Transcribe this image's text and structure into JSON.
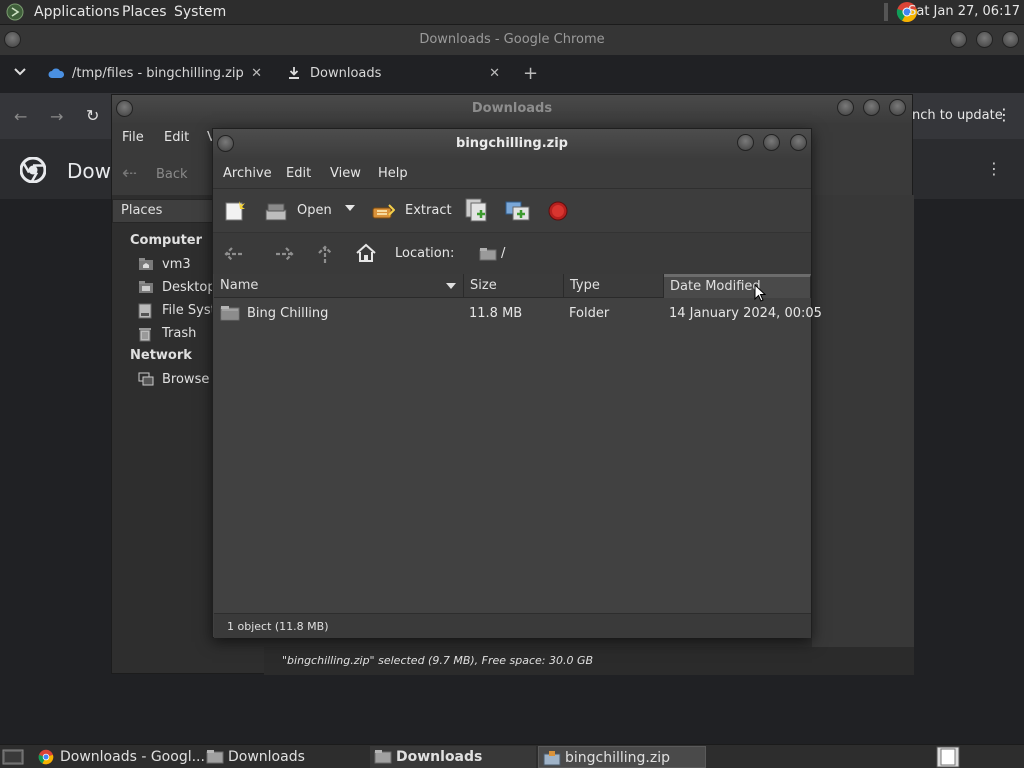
{
  "top_panel": {
    "menus": [
      "Applications",
      "Places",
      "System"
    ],
    "clock": "Sat Jan 27, 06:17"
  },
  "chrome": {
    "window_title": "Downloads - Google Chrome",
    "tabs": [
      {
        "label": "/tmp/files - bingchilling.zip"
      },
      {
        "label": "Downloads"
      }
    ],
    "update_text": "nch to update",
    "page_title": "Dow"
  },
  "nautilus": {
    "window_title": "Downloads",
    "menus": [
      "File",
      "Edit",
      "V"
    ],
    "back_label": "Back",
    "places_label": "Places",
    "sidebar": {
      "computer_heading": "Computer",
      "computer_items": [
        "vm3",
        "Desktop",
        "File Syst",
        "Trash"
      ],
      "network_heading": "Network",
      "network_items": [
        "Browse I"
      ]
    },
    "status": "\"bingchilling.zip\" selected (9.7 MB), Free space: 30.0 GB"
  },
  "file_roller": {
    "window_title": "bingchilling.zip",
    "menus": [
      "Archive",
      "Edit",
      "View",
      "Help"
    ],
    "toolbar": {
      "open_label": "Open",
      "extract_label": "Extract"
    },
    "location_label": "Location:",
    "location_path": "/",
    "columns": [
      "Name",
      "Size",
      "Type",
      "Date Modified"
    ],
    "rows": [
      {
        "name": "Bing Chilling",
        "size": "11.8 MB",
        "type": "Folder",
        "date": "14 January 2024, 00:05"
      }
    ],
    "status": "1 object (11.8 MB)"
  },
  "taskbar": {
    "items": [
      "Downloads - Googl...",
      "Downloads",
      "Downloads",
      "bingchilling.zip"
    ]
  },
  "colors": {
    "accent": "#8ab4f8",
    "background": "#26272b"
  }
}
